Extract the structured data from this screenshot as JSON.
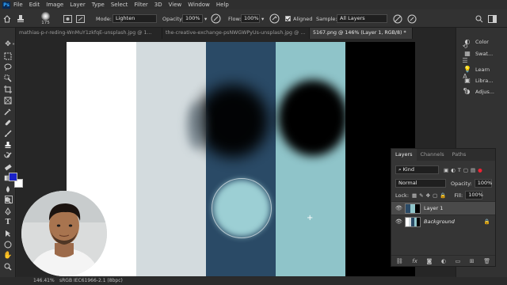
{
  "app": {
    "logo": "Ps"
  },
  "menu": [
    "File",
    "Edit",
    "Image",
    "Layer",
    "Type",
    "Select",
    "Filter",
    "3D",
    "View",
    "Window",
    "Help"
  ],
  "options": {
    "brush_size": "175",
    "mode_label": "Mode:",
    "mode_value": "Lighten",
    "opacity_label": "Opacity:",
    "opacity_value": "100%",
    "flow_label": "Flow:",
    "flow_value": "100%",
    "aligned_label": "Aligned",
    "sample_label": "Sample:",
    "sample_value": "All Layers"
  },
  "tabs": [
    {
      "label": "mathias-p-r-reding-WnMuY1zkfqE-unsplash.jpg @ 1...",
      "active": false
    },
    {
      "label": "the-creative-exchange-psNWGWPyUs-unsplash.jpg @ ...",
      "active": false
    },
    {
      "label": "5167.png @ 146% (Layer 1, RGB/8) *",
      "active": true
    }
  ],
  "canvas": {
    "colors": [
      "#ffffff",
      "#d3dbde",
      "#2a4a66",
      "#8fc4c9",
      "#000000"
    ]
  },
  "status": {
    "zoom": "146.41%",
    "profile": "sRGB IEC61966-2.1 (8bpc)"
  },
  "right_panel": {
    "items": [
      "Color",
      "Swat...",
      "Learn",
      "Libra...",
      "Adjus..."
    ]
  },
  "layers_panel": {
    "tabs": [
      "Layers",
      "Channels",
      "Paths"
    ],
    "filter_label": "Kind",
    "blend_mode": "Normal",
    "opacity_label": "Opacity:",
    "opacity_value": "100%",
    "lock_label": "Lock:",
    "fill_label": "Fill:",
    "fill_value": "100%",
    "layers": [
      {
        "name": "Layer 1",
        "selected": true
      },
      {
        "name": "Background",
        "selected": false
      }
    ]
  },
  "colors": {
    "foreground": "#1a22c8",
    "background": "#ffffff",
    "accent": "#31a8ff"
  }
}
